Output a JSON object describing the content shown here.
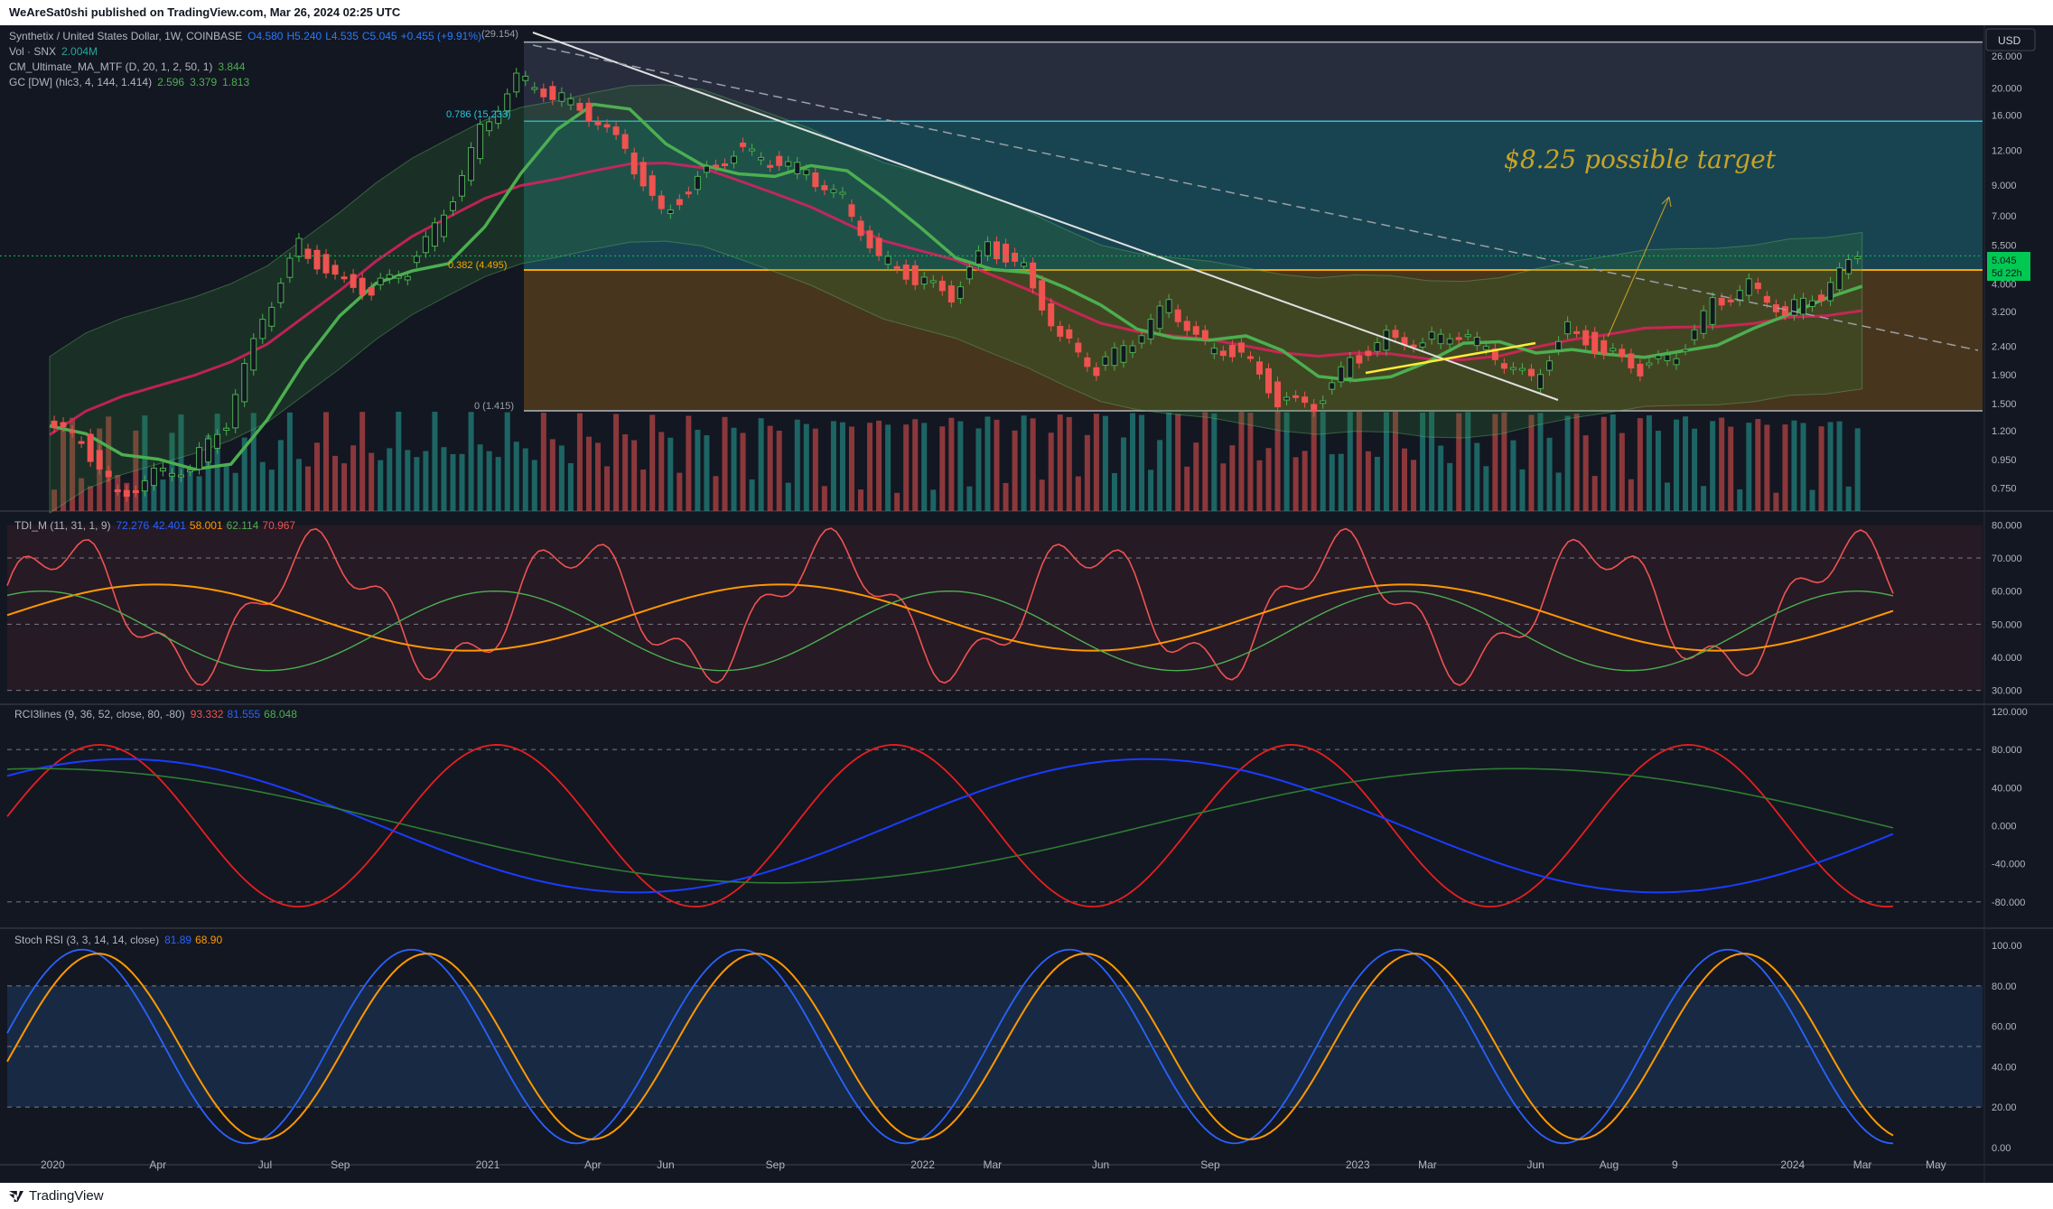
{
  "header": {
    "publish_line": "WeAreSat0shi published on TradingView.com, Mar 26, 2024 02:25 UTC"
  },
  "footer": {
    "brand": "TradingView"
  },
  "currency_button": "USD",
  "main_legend": {
    "symbol": "Synthetix / United States Dollar, 1W, COINBASE",
    "open": "O4.580",
    "high": "H5.240",
    "low": "L4.535",
    "close": "C5.045",
    "change": "+0.455 (+9.91%)",
    "vol_label": "Vol · SNX",
    "vol_value": "2.004M",
    "ma_label": "CM_Ultimate_MA_MTF (D, 20, 1, 2, 50, 1)",
    "ma_value": "3.844",
    "gc_label": "GC [DW] (hlc3, 4, 144, 1.414)",
    "gc_v1": "2.596",
    "gc_v2": "3.379",
    "gc_v3": "1.813"
  },
  "fib_labels": {
    "top": "(29.154)",
    "f786": "0.786 (15.233)",
    "f382": "0.382 (4.495)",
    "f0": "0 (1.415)"
  },
  "annotation_text": "$8.25 possible target",
  "price_badge": {
    "price": "5.045",
    "countdown": "5d 22h"
  },
  "tdi_legend": {
    "label": "TDI_M (11, 31, 1, 9)",
    "v1": "72.276",
    "v2": "42.401",
    "v3": "58.001",
    "v4": "62.114",
    "v5": "70.967"
  },
  "rci_legend": {
    "label": "RCI3lines (9, 36, 52, close, 80, -80)",
    "v1": "93.332",
    "v2": "81.555",
    "v3": "68.048"
  },
  "stoch_legend": {
    "label": "Stoch RSI (3, 3, 14, 14, close)",
    "k": "81.89",
    "d": "68.90"
  },
  "colors": {
    "bg": "#131722",
    "up": "#26a69a",
    "down": "#ef5350",
    "bright_green": "#4caf50",
    "fib_orange": "#f7a600",
    "teal_zone": "#1e6a78",
    "stoch_k": "#2962ff",
    "stoch_d": "#ff9800",
    "rci_short": "#e91e1e",
    "rci_mid": "#1a3cff",
    "rci_long": "#2e7d32",
    "annotation": "#c9a227"
  },
  "chart_data": [
    {
      "type": "candlestick",
      "title": "Synthetix / United States Dollar, 1W, COINBASE",
      "y_scale": "log",
      "y_ticks": [
        "26.000",
        "20.000",
        "16.000",
        "12.000",
        "9.000",
        "7.000",
        "5.500",
        "4.000",
        "3.200",
        "2.400",
        "1.900",
        "1.500",
        "1.200",
        "0.950",
        "0.750"
      ],
      "x_ticks": [
        "2020",
        "Apr",
        "Jul",
        "Sep",
        "2021",
        "Apr",
        "Jun",
        "Sep",
        "2022",
        "Mar",
        "Jun",
        "Sep",
        "2023",
        "Mar",
        "Jun",
        "Aug",
        "9",
        "2024",
        "Mar",
        "May"
      ],
      "ylim": [
        0.65,
        32
      ],
      "fib_levels": [
        {
          "ratio": "1",
          "price": 29.154
        },
        {
          "ratio": "0.786",
          "price": 15.233
        },
        {
          "ratio": "0.382",
          "price": 4.495
        },
        {
          "ratio": "0",
          "price": 1.415
        }
      ],
      "target": 8.25,
      "last_close": 5.045,
      "approx_closes": [
        {
          "date": "2020-01",
          "close": 1.25
        },
        {
          "date": "2020-02",
          "close": 1.1
        },
        {
          "date": "2020-03",
          "close": 0.7
        },
        {
          "date": "2020-04",
          "close": 0.85
        },
        {
          "date": "2020-05",
          "close": 0.9
        },
        {
          "date": "2020-06",
          "close": 1.3
        },
        {
          "date": "2020-07",
          "close": 3.0
        },
        {
          "date": "2020-08",
          "close": 5.5
        },
        {
          "date": "2020-09",
          "close": 4.2
        },
        {
          "date": "2020-10",
          "close": 3.8
        },
        {
          "date": "2020-11",
          "close": 4.5
        },
        {
          "date": "2020-12",
          "close": 7.0
        },
        {
          "date": "2021-01",
          "close": 14.0
        },
        {
          "date": "2021-02",
          "close": 22.0
        },
        {
          "date": "2021-03",
          "close": 19.0
        },
        {
          "date": "2021-04",
          "close": 16.0
        },
        {
          "date": "2021-05",
          "close": 12.0
        },
        {
          "date": "2021-06",
          "close": 7.0
        },
        {
          "date": "2021-07",
          "close": 9.5
        },
        {
          "date": "2021-08",
          "close": 12.0
        },
        {
          "date": "2021-09",
          "close": 11.0
        },
        {
          "date": "2021-10",
          "close": 10.0
        },
        {
          "date": "2021-11",
          "close": 8.0
        },
        {
          "date": "2021-12",
          "close": 5.0
        },
        {
          "date": "2022-01",
          "close": 4.2
        },
        {
          "date": "2022-02",
          "close": 3.6
        },
        {
          "date": "2022-03",
          "close": 5.5
        },
        {
          "date": "2022-04",
          "close": 4.5
        },
        {
          "date": "2022-05",
          "close": 2.6
        },
        {
          "date": "2022-06",
          "close": 2.0
        },
        {
          "date": "2022-07",
          "close": 2.5
        },
        {
          "date": "2022-08",
          "close": 3.4
        },
        {
          "date": "2022-09",
          "close": 2.4
        },
        {
          "date": "2022-10",
          "close": 2.3
        },
        {
          "date": "2022-11",
          "close": 1.55
        },
        {
          "date": "2022-12",
          "close": 1.45
        },
        {
          "date": "2023-01",
          "close": 2.1
        },
        {
          "date": "2023-02",
          "close": 2.6
        },
        {
          "date": "2023-03",
          "close": 2.5
        },
        {
          "date": "2023-04",
          "close": 2.7
        },
        {
          "date": "2023-05",
          "close": 2.2
        },
        {
          "date": "2023-06",
          "close": 1.8
        },
        {
          "date": "2023-07",
          "close": 2.8
        },
        {
          "date": "2023-08",
          "close": 2.3
        },
        {
          "date": "2023-09",
          "close": 2.0
        },
        {
          "date": "2023-10",
          "close": 2.2
        },
        {
          "date": "2023-11",
          "close": 3.4
        },
        {
          "date": "2023-12",
          "close": 4.0
        },
        {
          "date": "2024-01",
          "close": 3.2
        },
        {
          "date": "2024-02",
          "close": 3.7
        },
        {
          "date": "2024-03",
          "close": 5.045
        }
      ]
    },
    {
      "type": "line",
      "title": "TDI_M (11, 31, 1, 9)",
      "y_ticks": [
        "80.000",
        "70.000",
        "60.000",
        "50.000",
        "40.000",
        "30.000"
      ],
      "ylim": [
        28,
        82
      ]
    },
    {
      "type": "line",
      "title": "RCI3lines (9, 36, 52, close, 80, -80)",
      "y_ticks": [
        "120.000",
        "80.000",
        "40.000",
        "0.000",
        "-40.000",
        "-80.000"
      ],
      "ylim": [
        -100,
        120
      ]
    },
    {
      "type": "line",
      "title": "Stoch RSI (3, 3, 14, 14, close)",
      "y_ticks": [
        "100.00",
        "80.00",
        "60.00",
        "40.00",
        "20.00",
        "0.00"
      ],
      "ylim": [
        -5,
        105
      ],
      "band": [
        20,
        80
      ]
    }
  ]
}
